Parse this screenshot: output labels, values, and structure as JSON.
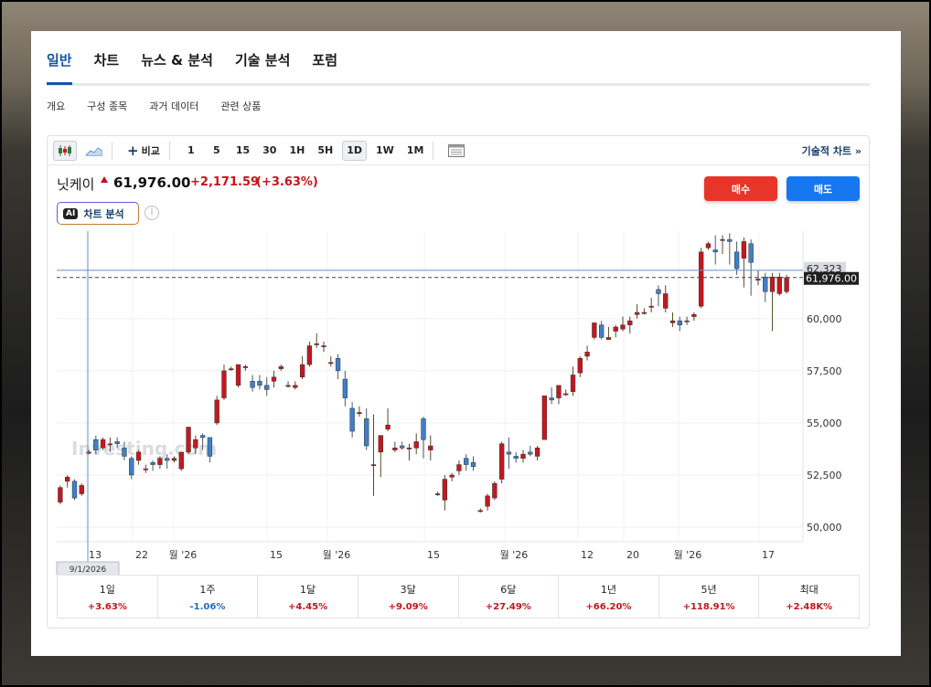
{
  "main_tabs": [
    "일반",
    "차트",
    "뉴스 & 분석",
    "기술 분석",
    "포럼"
  ],
  "sub_tabs": [
    "개요",
    "구성 종목",
    "과거 데이터",
    "관련 상품"
  ],
  "toolbar": {
    "compare": "비교",
    "intervals": [
      "1",
      "5",
      "15",
      "30",
      "1H",
      "5H",
      "1D",
      "1W",
      "1M"
    ],
    "selected_interval": "1D",
    "technical_chart": "기술적 차트 »"
  },
  "quote": {
    "name": "닛케이",
    "price": "61,976.00",
    "change": "+2,171.59",
    "change_pct": "(+3.63%)"
  },
  "buttons": {
    "buy": "매수",
    "sell": "매도"
  },
  "ai_chart": {
    "badge": "AI",
    "label": "차트 분석"
  },
  "watermark": "Investing.com",
  "chart_data": {
    "type": "candlestick",
    "y_ticks": [
      "60,000",
      "57,500",
      "55,000",
      "52,500",
      "50,000"
    ],
    "x_ticks": [
      "13",
      "22",
      "월 '26",
      "15",
      "월 '26",
      "15",
      "월 '26",
      "12",
      "20",
      "월 '26",
      "17"
    ],
    "crosshair_price": "62,323",
    "last_price_label": "61,976.00",
    "crosshair_date": "9/1/2026",
    "ylim": [
      49300,
      64200
    ],
    "candles": [
      [
        51200,
        52000,
        51100,
        51900
      ],
      [
        52200,
        52500,
        51900,
        52400
      ],
      [
        52200,
        52300,
        51300,
        51400
      ],
      [
        51600,
        52100,
        51500,
        52000
      ],
      [
        53600,
        53700,
        53500,
        53600
      ],
      [
        54200,
        54400,
        53500,
        53700
      ],
      [
        53800,
        54300,
        53700,
        54200
      ],
      [
        54000,
        54300,
        53600,
        54000
      ],
      [
        54100,
        54300,
        53800,
        54000
      ],
      [
        53800,
        54100,
        53200,
        53400
      ],
      [
        53300,
        53400,
        52300,
        52500
      ],
      [
        53200,
        53700,
        53000,
        53600
      ],
      [
        52800,
        53000,
        52600,
        52800
      ],
      [
        53100,
        53200,
        52700,
        53000
      ],
      [
        53000,
        53400,
        52800,
        53300
      ],
      [
        53300,
        53500,
        52800,
        53200
      ],
      [
        53200,
        53400,
        53100,
        53300
      ],
      [
        52800,
        53600,
        52700,
        53600
      ],
      [
        53600,
        54800,
        53500,
        54800
      ],
      [
        53800,
        54400,
        53500,
        54200
      ],
      [
        54400,
        54500,
        53700,
        54300
      ],
      [
        54300,
        54300,
        53100,
        53400
      ],
      [
        55000,
        56300,
        54900,
        56100
      ],
      [
        56200,
        57800,
        56100,
        57500
      ],
      [
        57600,
        57700,
        57500,
        57600
      ],
      [
        56800,
        57800,
        56700,
        57800
      ],
      [
        57700,
        57800,
        57500,
        57700
      ],
      [
        57000,
        57300,
        56500,
        56700
      ],
      [
        57000,
        57300,
        56600,
        56800
      ],
      [
        56800,
        57200,
        56300,
        56600
      ],
      [
        57000,
        57500,
        56700,
        57200
      ],
      [
        57600,
        57800,
        57500,
        57700
      ],
      [
        56800,
        57000,
        56700,
        56800
      ],
      [
        56700,
        57000,
        56600,
        56800
      ],
      [
        57200,
        58200,
        57100,
        57800
      ],
      [
        57800,
        58900,
        57700,
        58700
      ],
      [
        58800,
        59300,
        58600,
        58800
      ],
      [
        58700,
        58900,
        58400,
        58700
      ],
      [
        57900,
        58200,
        57700,
        57900
      ],
      [
        58100,
        58300,
        57100,
        57500
      ],
      [
        57100,
        57500,
        55800,
        56200
      ],
      [
        55700,
        56000,
        54300,
        54600
      ],
      [
        55500,
        55800,
        55300,
        55500
      ],
      [
        55200,
        55700,
        53700,
        53900
      ],
      [
        53000,
        55400,
        51500,
        53000
      ],
      [
        53600,
        54400,
        52400,
        54400
      ],
      [
        54700,
        55700,
        54600,
        54900
      ],
      [
        53700,
        54100,
        53600,
        53800
      ],
      [
        53900,
        54100,
        53700,
        53800
      ],
      [
        53800,
        54000,
        53200,
        53800
      ],
      [
        53800,
        54500,
        53500,
        54100
      ],
      [
        55200,
        55300,
        53300,
        54200
      ],
      [
        53700,
        54400,
        53200,
        53900
      ],
      [
        51600,
        51700,
        51500,
        51600
      ],
      [
        51300,
        52500,
        50800,
        52300
      ],
      [
        52400,
        52600,
        52200,
        52500
      ],
      [
        52700,
        53200,
        52500,
        53000
      ],
      [
        53300,
        53500,
        52700,
        53000
      ],
      [
        53100,
        53400,
        52700,
        52900
      ],
      [
        50800,
        50900,
        50700,
        50800
      ],
      [
        51000,
        51600,
        50800,
        51500
      ],
      [
        51400,
        52200,
        51300,
        52100
      ],
      [
        52300,
        54100,
        52100,
        54000
      ],
      [
        53600,
        54300,
        52800,
        53500
      ],
      [
        53400,
        53600,
        53100,
        53300
      ],
      [
        53300,
        53700,
        53100,
        53500
      ],
      [
        53600,
        53900,
        53400,
        53500
      ],
      [
        53400,
        53900,
        53200,
        53800
      ],
      [
        54200,
        56300,
        54200,
        56300
      ],
      [
        56200,
        56700,
        55900,
        56100
      ],
      [
        56200,
        56800,
        55900,
        56800
      ],
      [
        56400,
        56600,
        56300,
        56400
      ],
      [
        56500,
        57700,
        56300,
        57300
      ],
      [
        57400,
        58200,
        57200,
        58100
      ],
      [
        58200,
        58700,
        58000,
        58400
      ],
      [
        59100,
        59800,
        59000,
        59800
      ],
      [
        59700,
        59900,
        59000,
        59100
      ],
      [
        59000,
        59600,
        59000,
        59100
      ],
      [
        59400,
        59700,
        59100,
        59600
      ],
      [
        59500,
        60100,
        59400,
        59700
      ],
      [
        59700,
        60100,
        59300,
        59900
      ],
      [
        60200,
        60700,
        60000,
        60300
      ],
      [
        60300,
        60500,
        60200,
        60300
      ],
      [
        60600,
        61000,
        60300,
        60600
      ],
      [
        61400,
        61600,
        60600,
        61200
      ],
      [
        60500,
        61600,
        60300,
        61200
      ],
      [
        59800,
        60300,
        59600,
        59900
      ],
      [
        59900,
        60100,
        59400,
        59700
      ],
      [
        59900,
        60100,
        59700,
        59900
      ],
      [
        60100,
        60300,
        59900,
        60200
      ],
      [
        60600,
        63400,
        60500,
        63200
      ],
      [
        63400,
        63700,
        63300,
        63600
      ],
      [
        63300,
        64000,
        62600,
        63200
      ],
      [
        63800,
        64000,
        63100,
        63800
      ],
      [
        63800,
        64100,
        62600,
        63700
      ],
      [
        63200,
        63700,
        62100,
        62400
      ],
      [
        62900,
        63900,
        61500,
        63700
      ],
      [
        63600,
        63800,
        61100,
        62700
      ],
      [
        61900,
        62300,
        61600,
        61900
      ],
      [
        62000,
        62200,
        60800,
        61300
      ],
      [
        61300,
        62200,
        59400,
        62000
      ],
      [
        61200,
        62200,
        61100,
        62000
      ],
      [
        61300,
        62100,
        61200,
        61976
      ]
    ],
    "grid": true,
    "show_crosshair": true
  },
  "performance": [
    {
      "label": "1일",
      "value": "+3.63%",
      "dir": "pos"
    },
    {
      "label": "1주",
      "value": "-1.06%",
      "dir": "neg"
    },
    {
      "label": "1달",
      "value": "+4.45%",
      "dir": "pos"
    },
    {
      "label": "3달",
      "value": "+9.09%",
      "dir": "pos"
    },
    {
      "label": "6달",
      "value": "+27.49%",
      "dir": "pos"
    },
    {
      "label": "1년",
      "value": "+66.20%",
      "dir": "pos"
    },
    {
      "label": "5년",
      "value": "+118.91%",
      "dir": "pos"
    },
    {
      "label": "최대",
      "value": "+2.48K%",
      "dir": "pos"
    }
  ],
  "colors": {
    "up": "#c8161d",
    "down": "#3f7fc9",
    "accent": "#1256a0"
  }
}
